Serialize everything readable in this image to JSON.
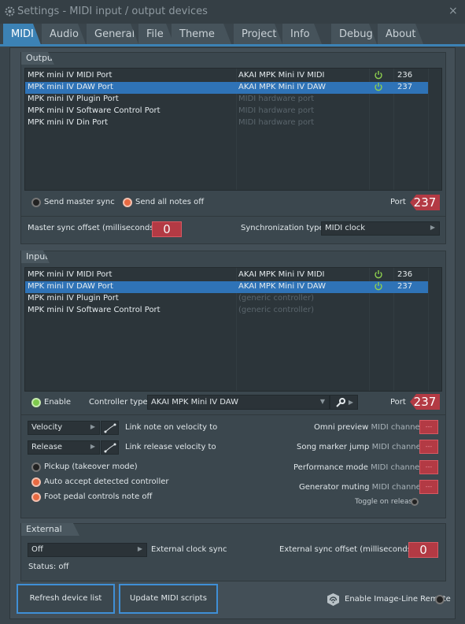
{
  "window": {
    "title": "Settings - MIDI input / output devices",
    "close_glyph": "×"
  },
  "tabs": [
    {
      "label": "MIDI"
    },
    {
      "label": "Audio"
    },
    {
      "label": "General"
    },
    {
      "label": "File"
    },
    {
      "label": "Theme"
    },
    {
      "label": "Project"
    },
    {
      "label": "Info"
    },
    {
      "label": "Debug"
    },
    {
      "label": "About"
    }
  ],
  "output": {
    "section_label": "Output",
    "rows": [
      {
        "name": "MPK mini IV MIDI Port",
        "device": "AKAI MPK Mini IV MIDI",
        "port": "236",
        "selected": false,
        "enabled": true
      },
      {
        "name": "MPK mini IV DAW Port",
        "device": "AKAI MPK Mini IV DAW",
        "port": "237",
        "selected": true,
        "enabled": true
      },
      {
        "name": "MPK mini IV Plugin Port",
        "device": "MIDI hardware port",
        "port": "",
        "selected": false,
        "enabled": false
      },
      {
        "name": "MPK mini IV Software Control Port",
        "device": "MIDI hardware port",
        "port": "",
        "selected": false,
        "enabled": false
      },
      {
        "name": "MPK mini IV Din Port",
        "device": "MIDI hardware port",
        "port": "",
        "selected": false,
        "enabled": false
      }
    ],
    "send_master_sync": "Send master sync",
    "send_all_notes_off": "Send all notes off",
    "port_label": "Port",
    "port_value": "237",
    "master_sync_offset_label": "Master sync offset (milliseconds)",
    "master_sync_offset_value": "0",
    "sync_type_label": "Synchronization type",
    "sync_type_value": "MIDI clock"
  },
  "input": {
    "section_label": "Input",
    "rows": [
      {
        "name": "MPK mini IV MIDI Port",
        "device": "AKAI MPK Mini IV MIDI",
        "port": "236",
        "selected": false,
        "enabled": true
      },
      {
        "name": "MPK mini IV DAW Port",
        "device": "AKAI MPK Mini IV DAW",
        "port": "237",
        "selected": true,
        "enabled": true
      },
      {
        "name": "MPK mini IV Plugin Port",
        "device": "(generic controller)",
        "port": "",
        "selected": false,
        "enabled": false
      },
      {
        "name": "MPK mini IV Software Control Port",
        "device": "(generic controller)",
        "port": "",
        "selected": false,
        "enabled": false
      }
    ],
    "enable_label": "Enable",
    "controller_type_label": "Controller type",
    "controller_type_value": "AKAI MPK Mini IV DAW",
    "port_label": "Port",
    "port_value": "237",
    "velocity_combo": "Velocity",
    "link_velocity_label": "Link note on velocity to",
    "release_combo": "Release",
    "link_release_label": "Link release velocity to",
    "pickup_label": "Pickup (takeover mode)",
    "auto_accept_label": "Auto accept detected controller",
    "foot_pedal_label": "Foot pedal controls note off",
    "omni_preview_label": "Omni preview",
    "song_marker_label": "Song marker jump",
    "performance_label": "Performance mode",
    "generator_muting_label": "Generator muting",
    "midi_channel_suffix": "MIDI channel",
    "channel_button_text": "---",
    "toggle_on_release_label": "Toggle on release"
  },
  "external_sync": {
    "section_label": "External sync",
    "combo_value": "Off",
    "clock_label": "External clock sync",
    "offset_label": "External sync offset (milliseconds)",
    "offset_value": "0",
    "status_text": "Status: off"
  },
  "footer": {
    "refresh_button": "Refresh device list",
    "update_scripts_button": "Update MIDI scripts",
    "remote_label": "Enable Image-Line Remote"
  },
  "colors": {
    "accent_blue": "#3c82b5",
    "selection_blue": "#2f73b7",
    "red_value": "#b33a44",
    "power_green": "#8fd14f"
  }
}
